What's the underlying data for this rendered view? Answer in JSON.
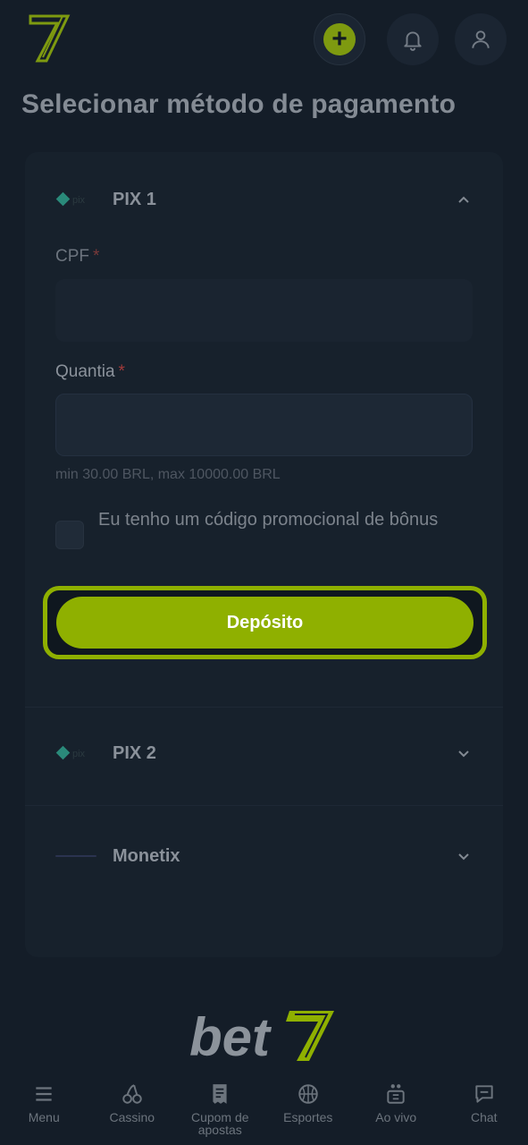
{
  "header": {
    "logo_icon": "bet7-seven-logo",
    "deposit_plus_icon": "plus-icon",
    "notifications_icon": "bell-icon",
    "profile_icon": "user-icon",
    "accent_color": "#8fb000"
  },
  "page": {
    "title": "Selecionar método de pagamento"
  },
  "methods": [
    {
      "name": "PIX 1",
      "logo_icon": "pix-logo",
      "expanded": true
    },
    {
      "name": "PIX 2",
      "logo_icon": "pix-logo",
      "expanded": false
    },
    {
      "name": "Monetix",
      "logo_icon": "monetix-logo",
      "expanded": false
    }
  ],
  "form": {
    "cpf_label": "CPF",
    "cpf_value": "",
    "amount_label": "Quantia",
    "amount_value": "",
    "required_mark": "*",
    "limits_hint": "min 30.00 BRL, max 10000.00 BRL",
    "promo_checkbox_label": "Eu tenho um código promocional de bônus",
    "promo_checked": false,
    "submit_label": "Depósito"
  },
  "footer": {
    "brand_logo": "bet7-logo"
  },
  "bottom_nav": [
    {
      "label": "Menu",
      "icon": "menu-icon"
    },
    {
      "label": "Cassino",
      "icon": "cherries-icon"
    },
    {
      "label": "Cupom de apostas",
      "icon": "receipt-icon"
    },
    {
      "label": "Esportes",
      "icon": "basketball-icon"
    },
    {
      "label": "Ao vivo",
      "icon": "live-icon"
    },
    {
      "label": "Chat",
      "icon": "chat-icon"
    }
  ]
}
